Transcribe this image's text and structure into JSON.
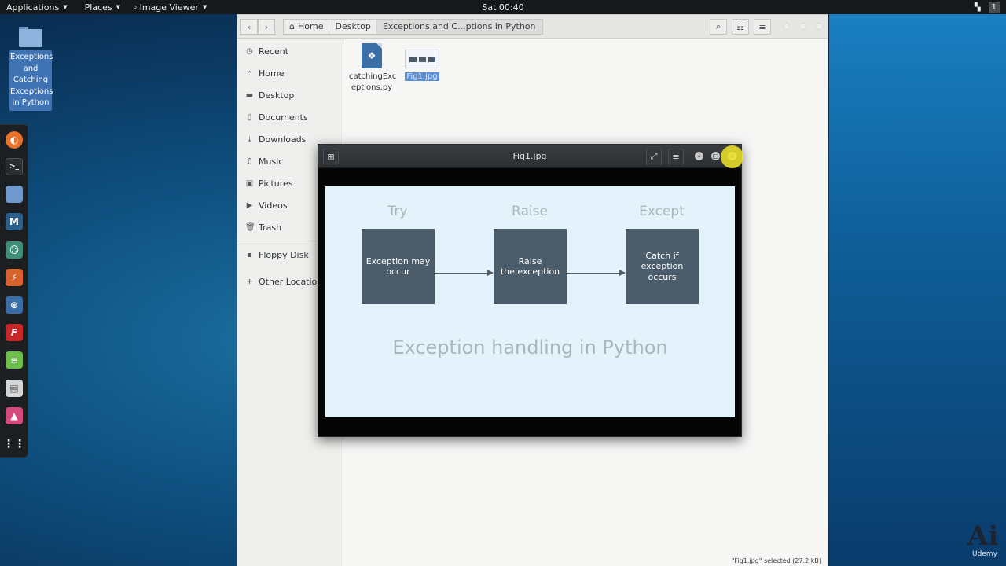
{
  "topbar": {
    "applications": "Applications",
    "places": "Places",
    "image_viewer": "Image Viewer",
    "clock": "Sat 00:40",
    "workspace": "1"
  },
  "desktop_icon": {
    "label_lines": [
      "Exceptions",
      "and",
      "Catching",
      "Exceptions",
      "in Python"
    ]
  },
  "dock": {
    "items": [
      "firefox",
      "terminal",
      "files",
      "metasploit",
      "armitage",
      "burpsuite",
      "beef",
      "faraday",
      "leafpad",
      "cherrytree",
      "image-viewer",
      "show-apps"
    ]
  },
  "file_manager": {
    "breadcrumbs": [
      "Home",
      "Desktop",
      "Exceptions and C...ptions in Python"
    ],
    "sidebar": [
      {
        "label": "Recent",
        "icon": "clock-icon"
      },
      {
        "label": "Home",
        "icon": "home-icon"
      },
      {
        "label": "Desktop",
        "icon": "folder-icon"
      },
      {
        "label": "Documents",
        "icon": "document-icon"
      },
      {
        "label": "Downloads",
        "icon": "download-icon"
      },
      {
        "label": "Music",
        "icon": "music-icon"
      },
      {
        "label": "Pictures",
        "icon": "picture-icon"
      },
      {
        "label": "Videos",
        "icon": "video-icon"
      },
      {
        "label": "Trash",
        "icon": "trash-icon"
      },
      {
        "label": "Floppy Disk",
        "icon": "floppy-icon"
      },
      {
        "label": "Other Locations",
        "icon": "plus-icon"
      }
    ],
    "files": [
      {
        "name_line1": "catchingExc",
        "name_line2": "eptions.py"
      },
      {
        "name": "Fig1.jpg"
      }
    ],
    "status": "\"Fig1.jpg\" selected  (27.2 kB)"
  },
  "image_viewer": {
    "title": "Fig1.jpg",
    "slide": {
      "stages": [
        "Try",
        "Raise",
        "Except"
      ],
      "boxes": [
        "Exception may\noccur",
        "Raise\nthe exception",
        "Catch if\nexception occurs"
      ],
      "caption": "Exception handling in Python"
    }
  },
  "watermark": {
    "logo": "Ai",
    "brand": "Udemy"
  },
  "colors": {
    "slide_bg": "#e4f3fb",
    "box_fill": "#4b5d6b",
    "selection": "#5b8fd6"
  }
}
